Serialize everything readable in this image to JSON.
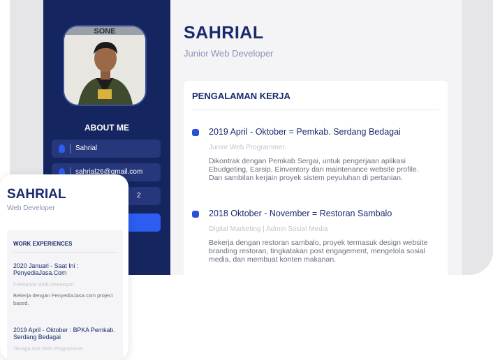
{
  "profile": {
    "name": "SAHRIAL",
    "role": "Junior Web Developer"
  },
  "sidebar": {
    "about_title": "ABOUT ME",
    "contacts": [
      {
        "icon": "user-icon",
        "text": "Sahrial"
      },
      {
        "icon": "email-icon",
        "text": "sahrial26@gmail.com"
      },
      {
        "icon": "phone-icon",
        "text": "2"
      }
    ]
  },
  "experience": {
    "title": "PENGALAMAN KERJA",
    "items": [
      {
        "heading": "2019 April - Oktober = Pemkab. Serdang Bedagai",
        "subtitle": "Junior Web Programmer",
        "description": "Dikontrak dengan Pemkab Sergai, untuk pengerjaan aplikasi Ebudgeting, Earsip, Einventory dan maintenance website profile. Dan sambilan kerjain proyek sistem peyuluhan di pertanian."
      },
      {
        "heading": "2018 Oktober - November = Restoran Sambalo",
        "subtitle": "Digital Marketing | Admin Sosial Media",
        "description": "Bekerja dengan restoran sambalo, proyek termasuk design website branding restoran, tingkatakan post engagement, mengelola sosial media, dan membuat konten makanan."
      }
    ]
  },
  "mobile": {
    "name": "SAHRIAL",
    "role": "Web Developer",
    "section_title": "WORK EXPERIENCES",
    "items": [
      {
        "heading": "2020 Januari - Saat Ini : PenyediaJasa.Com",
        "subtitle": "Freelance Web Developer",
        "description": "Bekerja dengan PenyediaJasa.com project based."
      },
      {
        "heading": "2019 April - Oktober : BPKA Pemkab. Serdang Bedagai",
        "subtitle": "Tenaga Ahli Web Programmer"
      }
    ]
  },
  "colors": {
    "navy": "#15255f",
    "accent_blue": "#2c5cf0",
    "title_navy": "#1a2a6c"
  }
}
